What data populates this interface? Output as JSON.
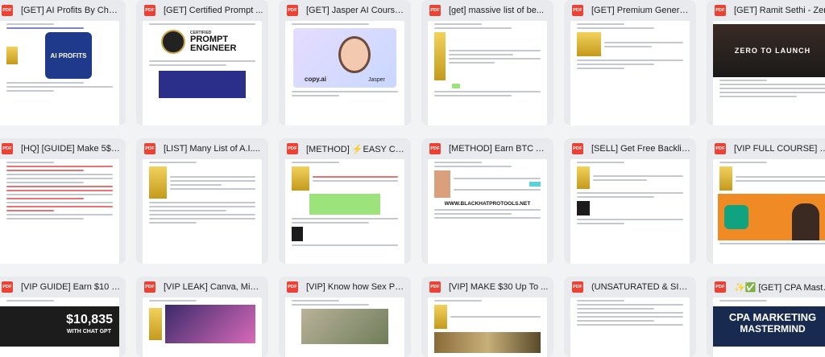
{
  "icon_label": "PDF",
  "files": [
    {
      "title": "[GET] AI Profits By Cha...",
      "thumb_text": "AI PROFITS"
    },
    {
      "title": "[GET] Certified Prompt ...",
      "thumb_text": "PROMPT ENGINEER",
      "thumb_sub": "CERTIFIED"
    },
    {
      "title": "[GET] Jasper AI Course...",
      "thumb_text": "copy.ai",
      "thumb_sub": "Jasper"
    },
    {
      "title": "[get] massive list of be..."
    },
    {
      "title": "[GET] Premium Genera..."
    },
    {
      "title": "[GET] Ramit Sethi - Zer...",
      "thumb_text": "ZERO TO LAUNCH"
    },
    {
      "title": "[HQ] [GUIDE] Make 5$ ..."
    },
    {
      "title": "[LIST] Many List of A.I...."
    },
    {
      "title": "[METHOD] ⚡EASY CC ..."
    },
    {
      "title": "[METHOD] Earn BTC A...",
      "thumb_text": "WWW.BLACKHATPROTOOLS.NET"
    },
    {
      "title": "[SELL] Get Free Backlin..."
    },
    {
      "title": "[VIP FULL COURSE] Ch..."
    },
    {
      "title": "[VIP GUIDE] Earn $10 E...",
      "thumb_text": "$10,835",
      "thumb_sub": "WITH CHAT GPT"
    },
    {
      "title": "[VIP LEAK] Canva, Midj..."
    },
    {
      "title": "[VIP] Know how Sex Pa..."
    },
    {
      "title": "[VIP] MAKE $30 Up To ..."
    },
    {
      "title": "(UNSATURATED & SIMP..."
    },
    {
      "title": "✨✅ [GET] CPA Maste...",
      "thumb_text": "CPA MARKETING",
      "thumb_sub": "MASTERMIND"
    }
  ]
}
